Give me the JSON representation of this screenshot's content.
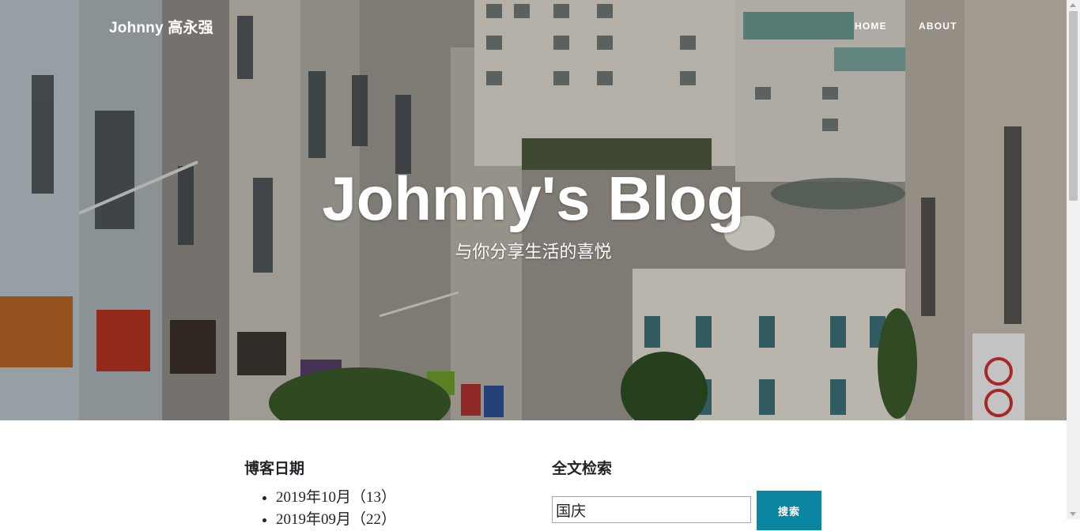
{
  "nav": {
    "brand": "Johnny 高永强",
    "links": [
      "HOME",
      "ABOUT"
    ]
  },
  "hero": {
    "title": "Johnny's Blog",
    "subtitle": "与你分享生活的喜悦"
  },
  "archive": {
    "heading": "博客日期",
    "items": [
      "2019年10月（13）",
      "2019年09月（22）"
    ]
  },
  "search": {
    "heading": "全文检索",
    "value": "国庆",
    "button": "搜索"
  },
  "colors": {
    "accent": "#0c85a1",
    "text": "#212529"
  }
}
